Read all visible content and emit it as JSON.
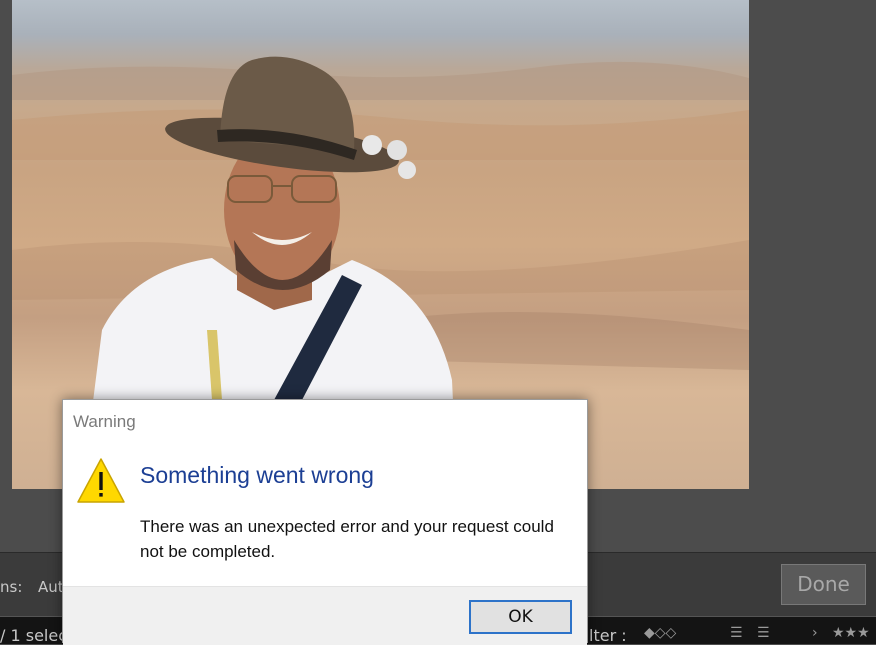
{
  "dialog": {
    "title": "Warning",
    "heading": "Something went wrong",
    "message": "There was an unexpected error and your request could not be completed.",
    "ok_label": "OK",
    "icon": "warning-triangle-icon",
    "heading_color": "#1c3f94"
  },
  "toolbar": {
    "left_label": "ns:",
    "auto_label": "Aut",
    "done_label": "Done"
  },
  "filmstrip": {
    "selection_text": "/ 1 selec",
    "filter_label": "lter :"
  },
  "colors": {
    "accent": "#2d73c9",
    "workspace": "#4c4c4c"
  }
}
